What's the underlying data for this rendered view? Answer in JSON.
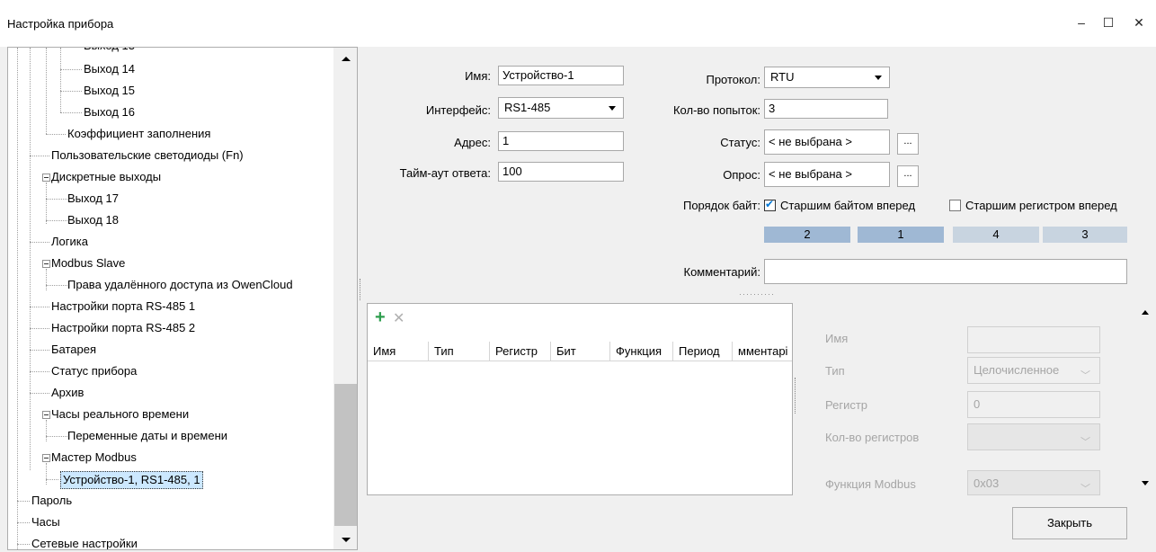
{
  "window": {
    "title": "Настройка прибора",
    "minimize_glyph": "–",
    "maximize_glyph": "☐",
    "close_glyph": "✕"
  },
  "tree": {
    "items": [
      {
        "label": "Выход 14"
      },
      {
        "label": "Выход 15"
      },
      {
        "label": "Выход 16"
      },
      {
        "label": "Коэффициент заполнения"
      },
      {
        "label": "Пользовательские светодиоды (Fn)"
      },
      {
        "label": "Дискретные выходы"
      },
      {
        "label": "Выход 17"
      },
      {
        "label": "Выход 18"
      },
      {
        "label": "Логика"
      },
      {
        "label": "Modbus Slave"
      },
      {
        "label": "Права удалённого доступа из OwenCloud"
      },
      {
        "label": "Настройки порта RS-485 1"
      },
      {
        "label": "Настройки порта RS-485 2"
      },
      {
        "label": "Батарея"
      },
      {
        "label": "Статус прибора"
      },
      {
        "label": "Архив"
      },
      {
        "label": "Часы реального времени"
      },
      {
        "label": "Переменные даты и времени"
      },
      {
        "label": "Мастер Modbus"
      },
      {
        "label": "Устройство-1, RS1-485, 1",
        "selected": true
      },
      {
        "label": "Пароль"
      },
      {
        "label": "Часы"
      },
      {
        "label": "Сетевые настройки"
      }
    ],
    "selected_color": "#cce8ff"
  },
  "form": {
    "name_label": "Имя:",
    "name_value": "Устройство-1",
    "interface_label": "Интерфейс:",
    "interface_value": "RS1-485",
    "address_label": "Адрес:",
    "address_value": "1",
    "timeout_label": "Тайм-аут ответа:",
    "timeout_value": "100",
    "protocol_label": "Протокол:",
    "protocol_value": "RTU",
    "retries_label": "Кол-во попыток:",
    "retries_value": "3",
    "status_label": "Статус:",
    "status_value": "< не выбрана >",
    "poll_label": "Опрос:",
    "poll_value": "< не выбрана >",
    "dots": "...",
    "byteorder_label": "Порядок байт:",
    "high_byte_first_label": "Старшим байтом вперед",
    "high_byte_first_checked": true,
    "high_register_first_label": "Старшим регистром вперед",
    "high_register_first_checked": false,
    "byte_boxes": [
      "2",
      "1",
      "4",
      "3"
    ],
    "byte_box_colors": [
      "#9fb8d4",
      "#9fb8d4",
      "#c8d4e0",
      "#c8d4e0"
    ],
    "comment_label": "Комментарий:",
    "comment_value": ""
  },
  "table": {
    "add_glyph": "+",
    "delete_glyph": "✕",
    "columns": [
      "Имя",
      "Тип",
      "Регистр",
      "Бит",
      "Функция",
      "Период",
      "мментарі"
    ]
  },
  "props": {
    "name_label": "Имя",
    "name_value": "",
    "type_label": "Тип",
    "type_value": "Целочисленное",
    "register_label": "Регистр",
    "register_value": "0",
    "reg_count_label": "Кол-во регистров",
    "reg_count_value": "",
    "function_label": "Функция Modbus",
    "function_value": "0x03"
  },
  "close_button": "Закрыть",
  "accent_color": "#0078d7"
}
